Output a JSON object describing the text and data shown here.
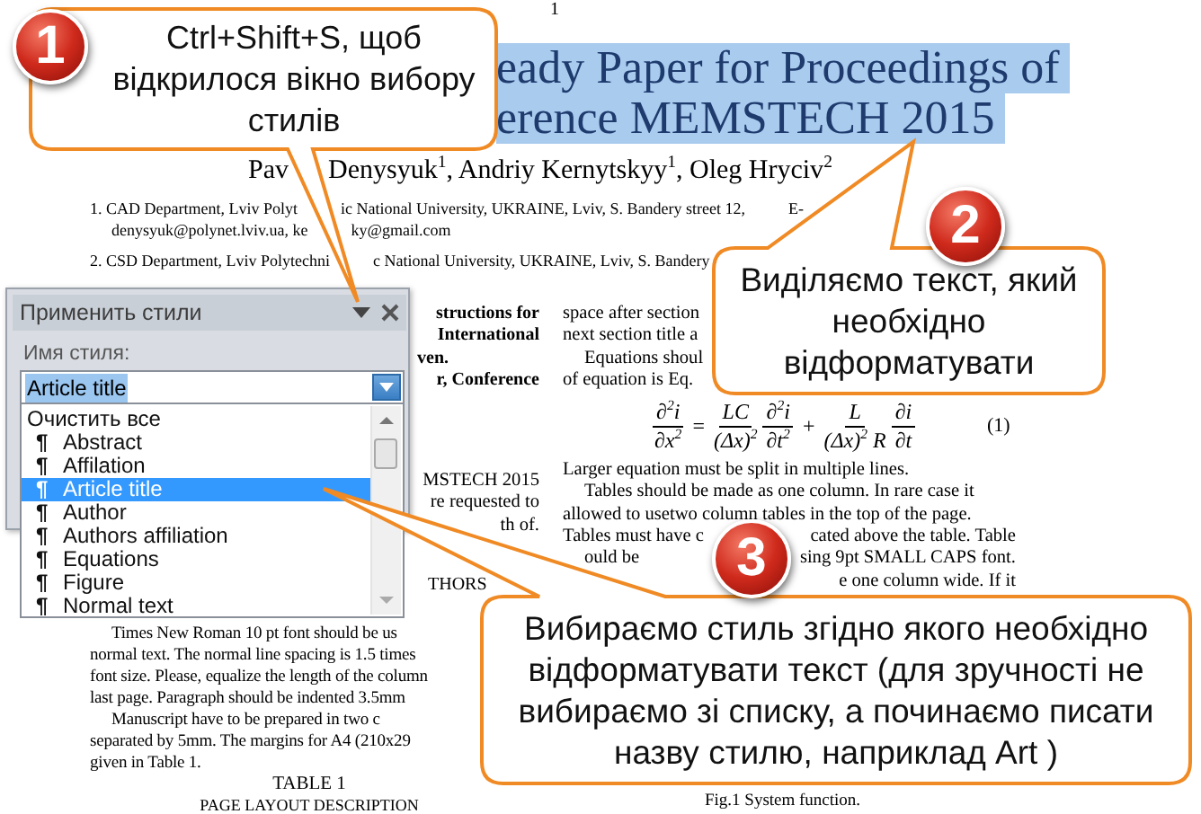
{
  "document": {
    "page_number": "1",
    "title": {
      "selected": true,
      "lines": [
        "eady Paper for Proceedings of",
        "erence MEMSTECH 2015"
      ]
    },
    "authors": [
      "Pav",
      "Denysyuk$^{1}$, Andriy Kernytskyy$^{1}$, Oleg Hryciv$^{2}$"
    ],
    "affiliations": [
      {
        "lines": [
          {
            "kind": "line",
            "parts": [
              "1. CAD Department, Lviv Polyt",
              "ic National University, UKRAINE, Lviv, S. Bandery street 12,",
              "E-"
            ]
          },
          {
            "kind": "indent",
            "parts": [
              "denysyuk@polynet.lviv.ua, ke",
              "ky@gmail.com"
            ]
          }
        ]
      },
      {
        "lines": [
          {
            "kind": "line",
            "parts": [
              "2. CSD Department, Lviv Polytechni",
              "c National University, UKRAINE, Lviv, S. Bandery"
            ]
          }
        ]
      }
    ],
    "left_column_top": [
      {
        "kind": "tail",
        "parts": [
          "structions for"
        ]
      },
      {
        "kind": "tail",
        "parts": [
          "International"
        ]
      },
      {
        "kind": "line",
        "parts": [
          "ven."
        ]
      },
      {
        "kind": "tail",
        "parts": [
          "r, Conference"
        ]
      }
    ],
    "left_column_middle": [
      {
        "kind": "tail",
        "parts": [
          "MSTECH 2015"
        ]
      },
      {
        "kind": "tail",
        "parts": [
          "re requested to"
        ]
      },
      {
        "kind": "tail",
        "parts": [
          "th of."
        ]
      }
    ],
    "section_heading": "THORS",
    "left_column_bottom": [
      {
        "kind": "indent",
        "parts": [
          "Times New Roman 10 pt font should be us"
        ]
      },
      {
        "kind": "line",
        "parts": [
          "normal text. The normal line spacing is 1.5 times"
        ]
      },
      {
        "kind": "line",
        "parts": [
          "font size. Please, equalize the length of the column"
        ]
      },
      {
        "kind": "line",
        "parts": [
          "last page. Paragraph should be indented 3.5mm"
        ]
      },
      {
        "kind": "indent",
        "parts": [
          "Manuscript have to be prepared in two c"
        ]
      },
      {
        "kind": "line",
        "parts": [
          "separated by 5mm. The margins for A4 (210x29"
        ]
      },
      {
        "kind": "line",
        "parts": [
          "given in Table 1."
        ]
      }
    ],
    "table_caption": "TABLE 1",
    "table_title": "PAGE LAYOUT DESCRIPTION",
    "right_column_top": [
      {
        "kind": "line",
        "parts": [
          "space after section"
        ]
      },
      {
        "kind": "line",
        "parts": [
          "next section title a"
        ]
      },
      {
        "kind": "indent",
        "parts": [
          "Equations shoul"
        ]
      },
      {
        "kind": "line",
        "parts": [
          "of equation is Eq."
        ]
      }
    ],
    "equation": {
      "parts": [
        {
          "kind": "frac",
          "num": "∂$^{2}$i",
          "den": "∂x$^{2}$"
        },
        {
          "kind": "op",
          "text": "="
        },
        {
          "kind": "frac",
          "num": "LC",
          "den": "(Δx)$^{2}$"
        },
        {
          "kind": "frac",
          "num": "∂$^{2}$i",
          "den": "∂t$^{2}$"
        },
        {
          "kind": "op",
          "text": "+"
        },
        {
          "kind": "frac",
          "num": "L",
          "den": "(Δx)$^{2}$ R"
        },
        {
          "kind": "frac",
          "num": "∂i",
          "den": "∂t"
        }
      ],
      "number": "(1)"
    },
    "right_column_bottom": [
      {
        "kind": "line",
        "parts": [
          "Larger equation must be split in multiple lines."
        ]
      },
      {
        "kind": "indent",
        "parts": [
          "Tables should be made as one column. In rare case it"
        ]
      },
      {
        "kind": "line",
        "parts": [
          "allowed to usetwo column tables in the top of the page."
        ]
      },
      {
        "kind": "split",
        "parts": [
          "Tables must have c",
          "cated above the table. Table"
        ]
      },
      {
        "kind": "split-indent",
        "parts": [
          "ould be",
          "sing 9pt SMALL CAPS font."
        ]
      },
      {
        "kind": "tail",
        "parts": [
          "e one column wide. If it"
        ]
      }
    ],
    "figure_caption": "Fig.1 System function."
  },
  "styles_pane": {
    "title": "Применить стили",
    "field_label": "Имя стиля:",
    "style_name": "Article title",
    "value_highlighted": true,
    "items": [
      {
        "kind": "command",
        "label": "Очистить все",
        "selected": false
      },
      {
        "kind": "style",
        "mark": "¶",
        "label": "Abstract",
        "selected": false
      },
      {
        "kind": "style",
        "mark": "¶",
        "label": "Affilation",
        "selected": false
      },
      {
        "kind": "style",
        "mark": "¶",
        "label": "Article title",
        "selected": true
      },
      {
        "kind": "style",
        "mark": "¶",
        "label": "Author",
        "selected": false
      },
      {
        "kind": "style",
        "mark": "¶",
        "label": "Authors affiliation",
        "selected": false
      },
      {
        "kind": "style",
        "mark": "¶",
        "label": "Equations",
        "selected": false
      },
      {
        "kind": "style",
        "mark": "¶",
        "label": "Figure",
        "selected": false
      },
      {
        "kind": "style",
        "mark": "¶",
        "label": "Normal text",
        "selected": false
      }
    ]
  },
  "callouts": [
    {
      "step": "1",
      "text": "Ctrl+Shift+S, щоб відкрилося вікно вибору стилів"
    },
    {
      "step": "2",
      "text": "Виділяємо текст, який необхідно відформатувати"
    },
    {
      "step": "3",
      "text": "Вибираємо стиль згідно якого необхідно відформатувати текст (для зручності не вибираємо зі списку, а починаємо писати назву стилю, наприклад Art )"
    }
  ]
}
